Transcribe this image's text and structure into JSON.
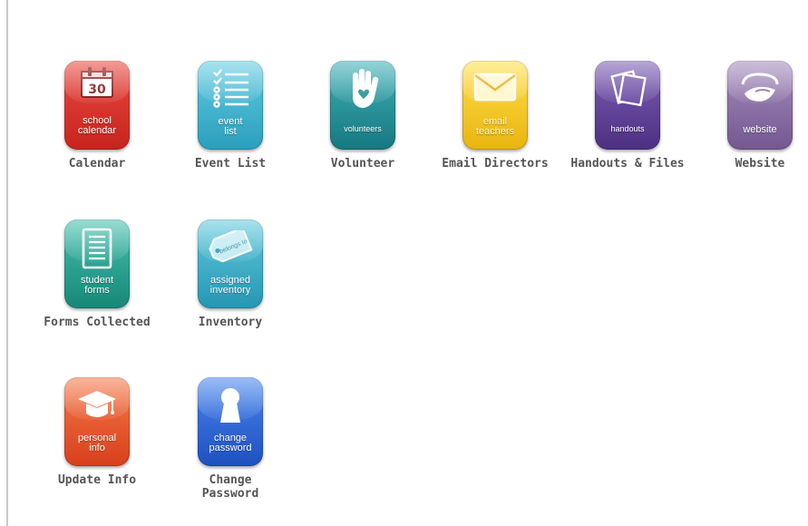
{
  "tiles": [
    {
      "icon_text": "school\ncalendar",
      "label": "Calendar",
      "color": "#d9312b",
      "icon": "calendar-icon"
    },
    {
      "icon_text": "event\nlist",
      "label": "Event List",
      "color": "#37b3cf",
      "icon": "list-icon"
    },
    {
      "icon_text": "volunteers",
      "label": "Volunteer",
      "color": "#1f8c94",
      "icon": "hand-heart-icon"
    },
    {
      "icon_text": "email\nteachers",
      "label": "Email Directors",
      "color": "#f2c419",
      "icon": "envelope-icon"
    },
    {
      "icon_text": "handouts",
      "label": "Handouts & Files",
      "color": "#5d3f93",
      "icon": "papers-icon"
    },
    {
      "icon_text": "website",
      "label": "Website",
      "color": "#8a6ea6",
      "icon": "globe-swoosh-icon"
    },
    {
      "icon_text": "student\nforms",
      "label": "Forms Collected",
      "color": "#1f9e90",
      "icon": "document-icon"
    },
    {
      "icon_text": "assigned\ninventory",
      "label": "Inventory",
      "color": "#33b0c8",
      "icon": "tag-icon"
    },
    {
      "icon_text": "personal\ninfo",
      "label": "Update Info",
      "color": "#e8532a",
      "icon": "graduation-cap-icon"
    },
    {
      "icon_text": "change\npassword",
      "label": "Change\nPassword",
      "color": "#2b66d6",
      "icon": "keyhole-icon"
    }
  ],
  "calendar_day": "30",
  "tag_text": "belongs to"
}
